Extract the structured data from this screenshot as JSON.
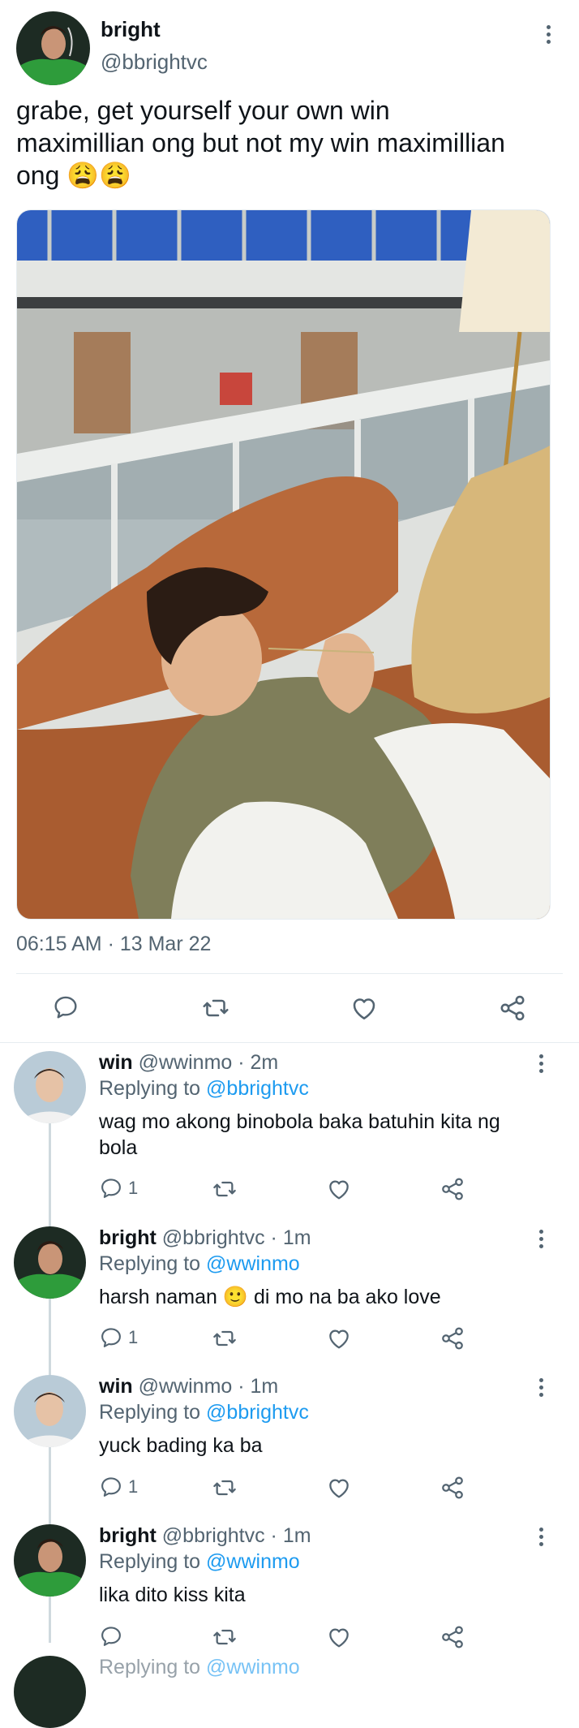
{
  "tweet": {
    "author_name": "bright",
    "author_handle": "@bbrightvc",
    "text_line1": "grabe, get yourself your own win",
    "text_line2": "maximillian ong but not my win maximillian",
    "text_line3": "ong",
    "emoji": "😩😩",
    "timestamp": "06:15 AM · 13 Mar 22"
  },
  "replies": [
    {
      "name": "win",
      "handle": "@wwinmo",
      "time": "2m",
      "replying_prefix": "Replying to ",
      "replying_to": "@bbrightvc",
      "text_line1": "wag mo akong binobola baka batuhin kita ng",
      "text_line2": "bola",
      "reply_count": "1"
    },
    {
      "name": "bright",
      "handle": "@bbrightvc",
      "time": "1m",
      "replying_prefix": "Replying to ",
      "replying_to": "@wwinmo",
      "text_before": "harsh naman ",
      "text_emoji": "🙂",
      "text_after": " di mo na ba ako love",
      "reply_count": "1"
    },
    {
      "name": "win",
      "handle": "@wwinmo",
      "time": "1m",
      "replying_prefix": "Replying to ",
      "replying_to": "@bbrightvc",
      "text_line1": "yuck bading ka ba",
      "reply_count": "1"
    },
    {
      "name": "bright",
      "handle": "@bbrightvc",
      "time": "1m",
      "replying_prefix": "Replying to ",
      "replying_to": "@wwinmo",
      "text_line1": "lika dito kiss kita",
      "reply_count": ""
    }
  ],
  "partial_next": {
    "replying_prefix": "Replying to ",
    "replying_to": "@wwinmo"
  },
  "separator": " · ",
  "colors": {
    "accent": "#1d9bf0",
    "muted": "#536471",
    "text": "#0f1419",
    "thread_line": "#cfd9de"
  },
  "icons": [
    "reply-icon",
    "retweet-icon",
    "like-icon",
    "share-icon",
    "more-icon"
  ]
}
